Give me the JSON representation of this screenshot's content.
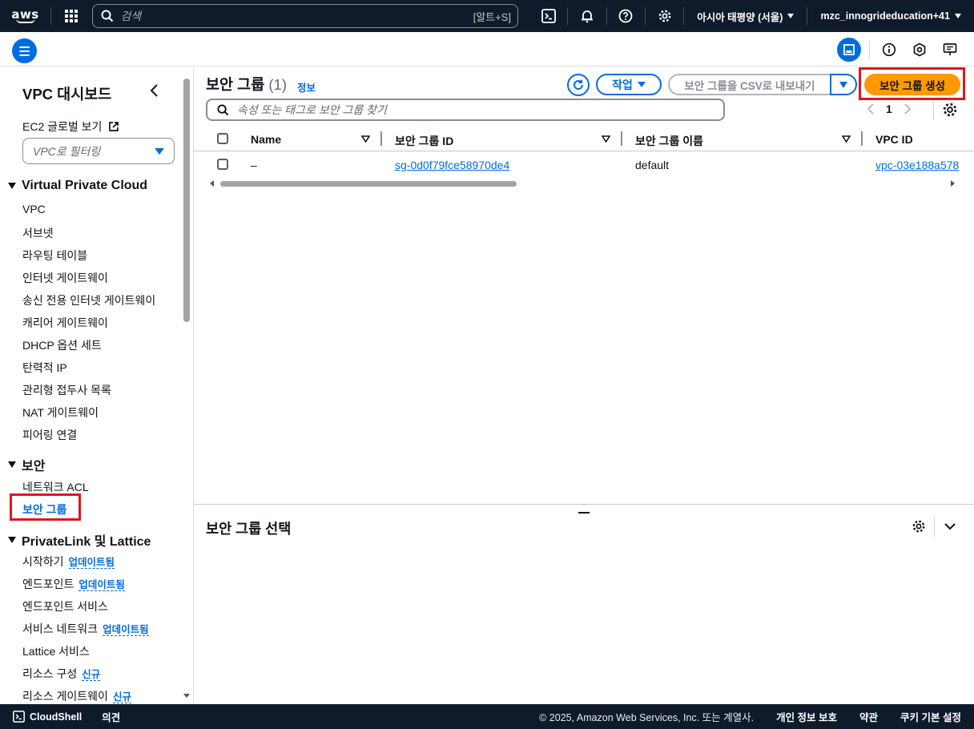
{
  "topnav": {
    "logo_text": "aws",
    "search_placeholder": "검색",
    "search_shortcut": "[알트+S]",
    "region": "아시아 태평양 (서울)",
    "account": "mzc_innogrideducation+41"
  },
  "sidebar": {
    "title": "VPC 대시보드",
    "ec2_global_view": "EC2 글로벌 보기",
    "filter_placeholder": "VPC로 필터링",
    "section_vpc": "Virtual Private Cloud",
    "vpc_items": [
      "VPC",
      "서브넷",
      "라우팅 테이블",
      "인터넷 게이트웨이",
      "송신 전용 인터넷 게이트웨이",
      "캐리어 게이트웨이",
      "DHCP 옵션 세트",
      "탄력적 IP",
      "관리형 접두사 목록",
      "NAT 게이트웨이",
      "피어링 연결"
    ],
    "section_security": "보안",
    "security_items": [
      "네트워크 ACL",
      "보안 그룹"
    ],
    "section_privatelink": "PrivateLink 및 Lattice",
    "privatelink_items": [
      {
        "label": "시작하기",
        "badge": "업데이트됨"
      },
      {
        "label": "엔드포인트",
        "badge": "업데이트됨"
      },
      {
        "label": "엔드포인트 서비스",
        "badge": ""
      },
      {
        "label": "서비스 네트워크",
        "badge": "업데이트됨"
      },
      {
        "label": "Lattice 서비스",
        "badge": ""
      },
      {
        "label": "리소스 구성",
        "badge": "신규"
      },
      {
        "label": "리소스 게이트웨이",
        "badge": "신규"
      }
    ]
  },
  "main": {
    "title": "보안 그룹",
    "count": "(1)",
    "info": "정보",
    "actions_label": "작업",
    "csv_label": "보안 그룹을 CSV로 내보내기",
    "create_label": "보안 그룹 생성",
    "search_placeholder": "속성 또는 태그로 보안 그룹 찾기",
    "page": "1",
    "columns": [
      "Name",
      "보안 그룹 ID",
      "보안 그룹 이름",
      "VPC ID"
    ],
    "rows": [
      {
        "name": "–",
        "sg_id": "sg-0d0f79fce58970de4",
        "sg_name": "default",
        "vpc_id": "vpc-03e188a578"
      }
    ],
    "detail_title": "보안 그룹 선택"
  },
  "footer": {
    "cloudshell": "CloudShell",
    "feedback": "의견",
    "copyright": "© 2025, Amazon Web Services, Inc. 또는 계열사.",
    "privacy": "개인 정보 보호",
    "terms": "약관",
    "cookies": "쿠키 기본 설정"
  },
  "colors": {
    "nav_bg": "#0f1b2a",
    "accent": "#006ce0",
    "primary_button": "#ff9900",
    "highlight_box": "#e0161e"
  }
}
